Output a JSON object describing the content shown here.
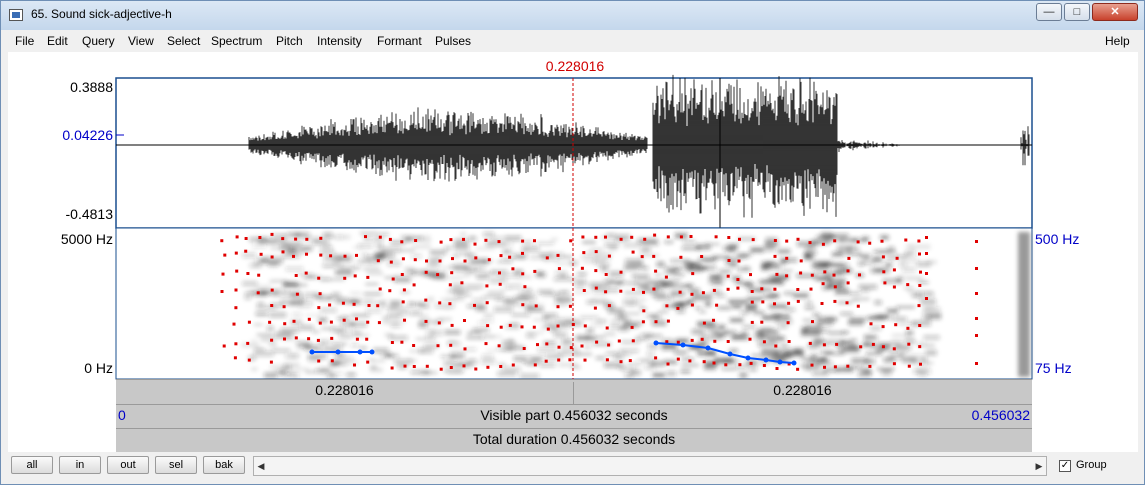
{
  "window": {
    "title": "65. Sound sick-adjective-h",
    "minimize": "—",
    "maximize": "□",
    "close": "✕"
  },
  "menu": [
    "File",
    "Edit",
    "Query",
    "View",
    "Select",
    "Spectrum",
    "Pitch",
    "Intensity",
    "Formant",
    "Pulses"
  ],
  "help": "Help",
  "cursor_time": "0.228016",
  "waveform": {
    "y_max": "0.3888",
    "y_cursor": "0.04226",
    "y_min": "-0.4813"
  },
  "spectrogram": {
    "freq_max": "5000 Hz",
    "freq_min": "0 Hz",
    "pitch_max": "500 Hz",
    "pitch_min": "75 Hz"
  },
  "time_bar": {
    "left_half": "0.228016",
    "right_half": "0.228016"
  },
  "visible_bar": {
    "start": "0",
    "label": "Visible part 0.456032 seconds",
    "end": "0.456032"
  },
  "total_bar": {
    "label": "Total duration 0.456032 seconds"
  },
  "buttons": {
    "all": "all",
    "in": "in",
    "out": "out",
    "sel": "sel",
    "bak": "bak"
  },
  "scroll": {
    "left": "◀",
    "right": "▶"
  },
  "group": {
    "label": "Group",
    "checked": "✓"
  },
  "colors": {
    "cursor": "#d10000",
    "formant": "#e00000",
    "pitch": "#0050ff",
    "axis_blue": "#0000c8"
  }
}
